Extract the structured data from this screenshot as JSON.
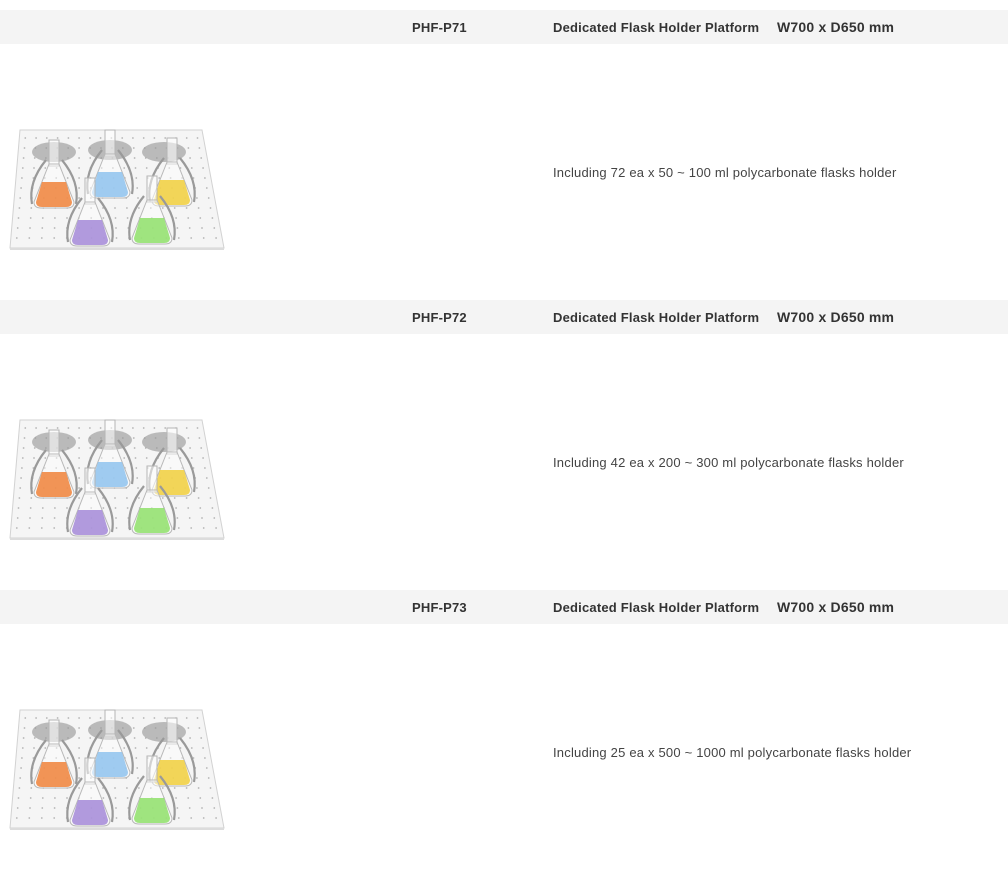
{
  "products": [
    {
      "code": "PHF-P71",
      "name": "Dedicated Flask Holder Platform",
      "size": "W700 x D650 mm",
      "description": "Including 72 ea x 50 ~ 100 ml polycarbonate flasks holder",
      "image_alt": "flask holder platform"
    },
    {
      "code": "PHF-P72",
      "name": "Dedicated Flask Holder Platform",
      "size": "W700 x D650 mm",
      "description": "Including 42 ea x 200 ~ 300 ml polycarbonate flasks holder",
      "image_alt": "flask holder platform"
    },
    {
      "code": "PHF-P73",
      "name": "Dedicated Flask Holder Platform",
      "size": "W700 x D650 mm",
      "description": "Including 25 ea x 500 ~ 1000 ml polycarbonate flasks holder",
      "image_alt": "flask holder platform"
    }
  ],
  "flask_colors": [
    "#f0833a",
    "#8fc3ef",
    "#f1cf3c",
    "#a48ad8",
    "#8fe06a"
  ],
  "colors": {
    "header_bg": "#f4f4f4",
    "text": "#333333"
  }
}
